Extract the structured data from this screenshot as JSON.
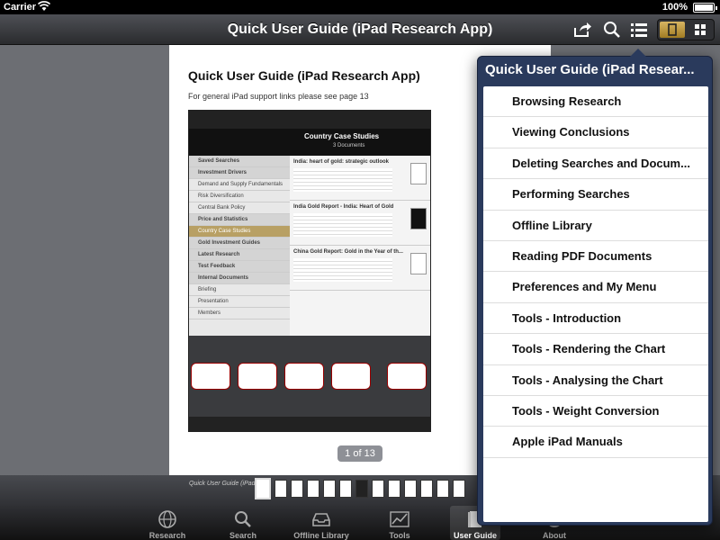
{
  "status": {
    "carrier": "Carrier",
    "time": "",
    "battery": "100%"
  },
  "navbar": {
    "title": "Quick User Guide (iPad Research App)"
  },
  "document": {
    "title": "Quick User Guide (iPad Research App)",
    "subtitle": "For general iPad support links please see page 13",
    "embedded": {
      "header_title": "Country Case Studies",
      "header_sub": "3 Documents",
      "sidebar": [
        "Saved Searches",
        "Investment Drivers",
        "Demand and Supply Fundamentals",
        "Risk Diversification",
        "Central Bank Policy",
        "Price and Statistics",
        "Country Case Studies",
        "Gold Investment Guides",
        "Latest Research",
        "Test Feedback",
        "Internal Documents",
        "Briefing",
        "Presentation",
        "Members"
      ],
      "items": [
        "India: heart of gold: strategic outlook",
        "India Gold Report - India: Heart of Gold",
        "China Gold Report: Gold in the Year of th..."
      ]
    },
    "page_indicator": "1 of 13"
  },
  "thumbstrip": {
    "label": "Quick User Guide (iPad Re..."
  },
  "tabbar": {
    "tabs": [
      {
        "label": "Research",
        "icon": "globe-icon"
      },
      {
        "label": "Search",
        "icon": "search-icon"
      },
      {
        "label": "Offline Library",
        "icon": "tray-icon"
      },
      {
        "label": "Tools",
        "icon": "chart-icon"
      },
      {
        "label": "User Guide",
        "icon": "book-icon"
      },
      {
        "label": "About",
        "icon": "info-icon"
      }
    ],
    "active": "User Guide"
  },
  "popover": {
    "title": "Quick User Guide (iPad Resear...",
    "items": [
      "Browsing Research",
      "Viewing Conclusions",
      "Deleting Searches and Docum...",
      "Performing Searches",
      "Offline Library",
      "Reading PDF Documents",
      "Preferences and My Menu",
      "Tools - Introduction",
      "Tools - Rendering the Chart",
      "Tools - Analysing the Chart",
      "Tools - Weight Conversion",
      "Apple iPad Manuals"
    ]
  },
  "colors": {
    "accent_gold": "#b08a33",
    "popover_bg": "#2a3a5c"
  }
}
